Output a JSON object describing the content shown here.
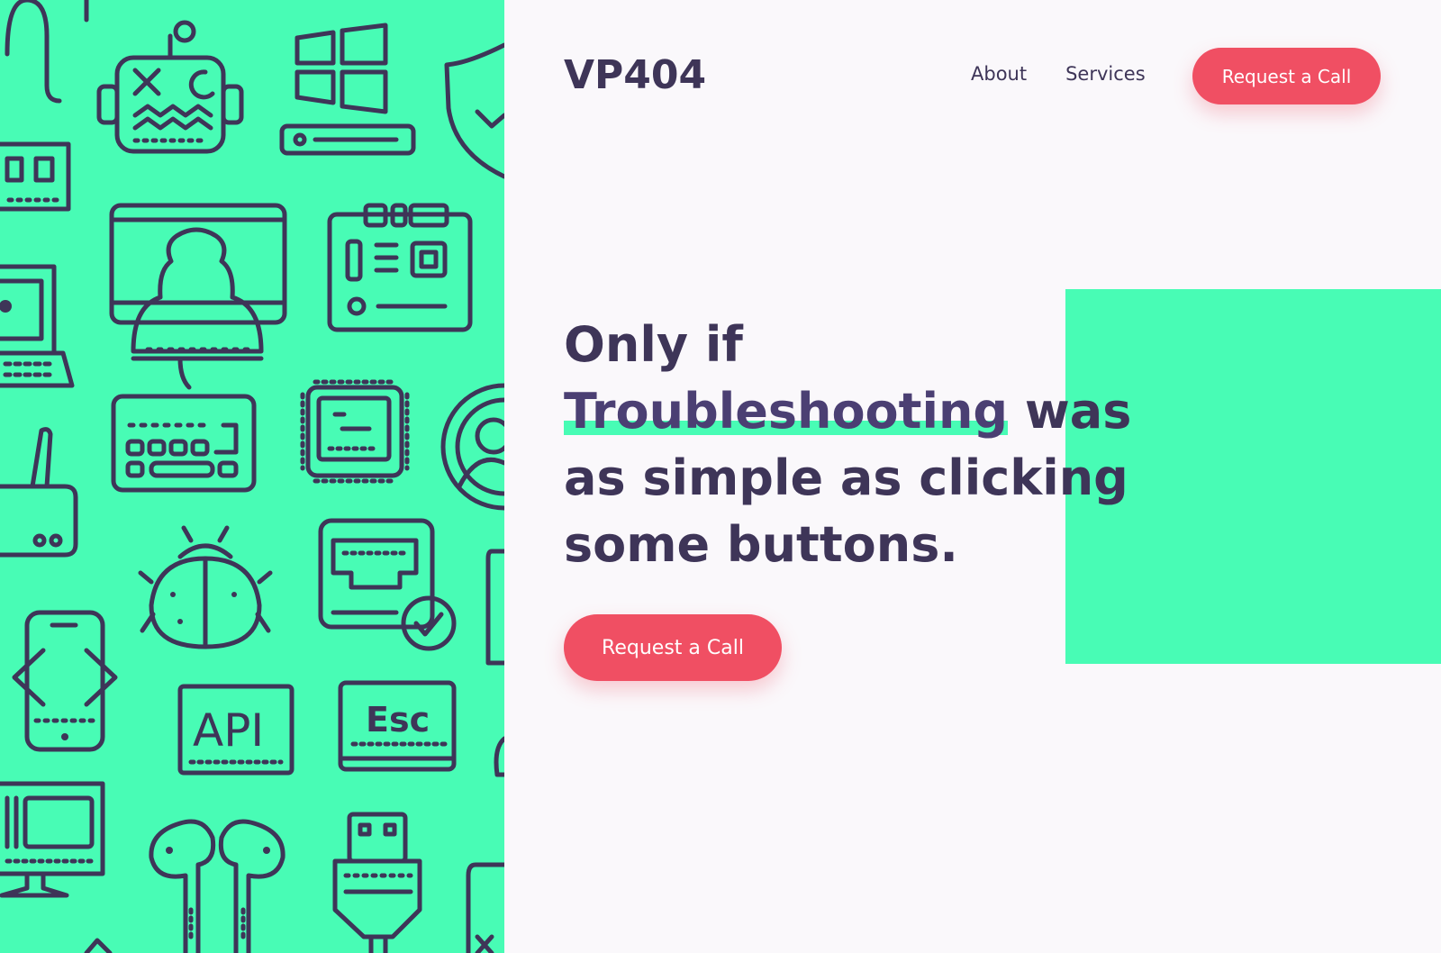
{
  "brand": {
    "name": "VP404"
  },
  "nav": {
    "items": [
      {
        "label": "About"
      },
      {
        "label": "Services"
      }
    ],
    "cta_label": "Request a Call"
  },
  "hero": {
    "title_before": "Only if",
    "title_highlight": "Troubleshooting",
    "title_after": "was as simple as clicking some buttons.",
    "cta_label": "Request a Call"
  },
  "illustration": {
    "api_label": "API",
    "esc_label": "Esc",
    "icons": [
      "cable-icon",
      "robot-icon",
      "windows-logo-icon",
      "shield-check-icon",
      "ram-chip-icon",
      "user-at-computer-icon",
      "motherboard-icon",
      "laptop-icon",
      "keyboard-icon",
      "cpu-chip-icon",
      "steering-wheel-icon",
      "router-icon",
      "bug-icon",
      "ethernet-port-icon",
      "phone-code-icon",
      "api-icon",
      "esc-key-icon",
      "monitor-icon",
      "earbuds-icon",
      "usb-plug-icon"
    ]
  },
  "colors": {
    "accent_green": "#48fcb5",
    "button_red": "#f04f63",
    "text_dark": "#3e3558",
    "background": "#faf8fb"
  }
}
